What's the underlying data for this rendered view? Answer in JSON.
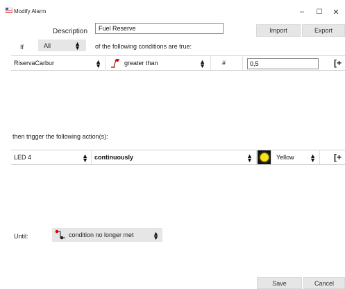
{
  "window": {
    "title": "Modify Alarm",
    "minimize": "–",
    "maximize": "☐",
    "close": "✕"
  },
  "header": {
    "description_label": "Description",
    "description_value": "Fuel Reserve",
    "import_label": "Import",
    "export_label": "Export",
    "if_label": "If",
    "match_selected": "All",
    "conditions_text": "of the following conditions are true:"
  },
  "condition": {
    "channel": "RiservaCarbur",
    "operator": "greater than",
    "value_symbol": "#",
    "value": "0,5"
  },
  "actions": {
    "heading": "then trigger the following action(s):",
    "output": "LED 4",
    "mode": "continuously",
    "color": "Yellow",
    "color_swatch": "#f5e21a"
  },
  "until": {
    "label": "Until:",
    "selected": "condition no longer met"
  },
  "footer": {
    "save_label": "Save",
    "cancel_label": "Cancel"
  },
  "icons": {
    "app": "alarm-flag-icon",
    "operator": "greater-than-graph-icon",
    "add": "add-row-icon",
    "until": "condition-until-icon"
  }
}
